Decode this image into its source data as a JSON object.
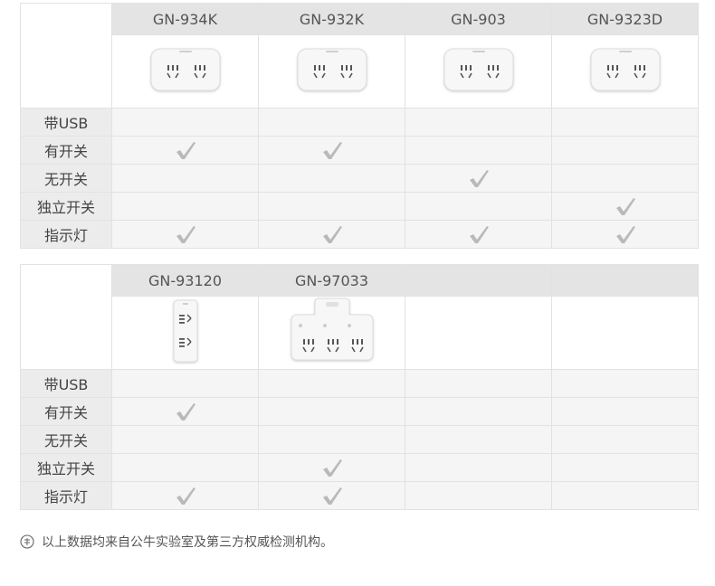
{
  "tables": [
    {
      "models": [
        "GN-934K",
        "GN-932K",
        "GN-903",
        "GN-9323D"
      ],
      "images": [
        "socket-horizontal-2",
        "socket-horizontal-2",
        "socket-horizontal-2",
        "socket-horizontal-2"
      ],
      "features": [
        {
          "label": "带USB",
          "checks": [
            false,
            false,
            false,
            false
          ]
        },
        {
          "label": "有开关",
          "checks": [
            true,
            true,
            false,
            false
          ]
        },
        {
          "label": "无开关",
          "checks": [
            false,
            false,
            true,
            false
          ]
        },
        {
          "label": "独立开关",
          "checks": [
            false,
            false,
            false,
            true
          ]
        },
        {
          "label": "指示灯",
          "checks": [
            true,
            true,
            true,
            true
          ]
        }
      ]
    },
    {
      "models": [
        "GN-93120",
        "GN-97033",
        "",
        ""
      ],
      "images": [
        "socket-vertical-2",
        "socket-t-3",
        "",
        ""
      ],
      "features": [
        {
          "label": "带USB",
          "checks": [
            false,
            false,
            false,
            false
          ]
        },
        {
          "label": "有开关",
          "checks": [
            true,
            false,
            false,
            false
          ]
        },
        {
          "label": "无开关",
          "checks": [
            false,
            false,
            false,
            false
          ]
        },
        {
          "label": "独立开关",
          "checks": [
            false,
            true,
            false,
            false
          ]
        },
        {
          "label": "指示灯",
          "checks": [
            true,
            true,
            false,
            false
          ]
        }
      ]
    }
  ],
  "footnote": {
    "icon": "info-circle-icon",
    "text": "以上数据均来自公牛实验室及第三方权威检测机构。"
  }
}
